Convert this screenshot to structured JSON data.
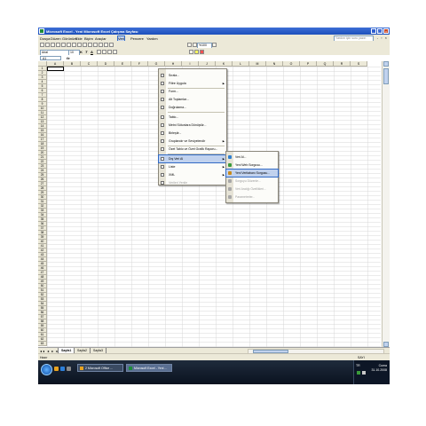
{
  "window": {
    "title": "Microsoft Excel - Yeni Microsoft Excel Çalışma Sayfası"
  },
  "menubar": {
    "items": [
      "Dosya",
      "Düzen",
      "Görünüm",
      "Ekle",
      "Biçim",
      "Araçlar",
      "Veri",
      "Pencere",
      "Yardım"
    ],
    "active_index": 6,
    "help_placeholder": "Yardım için soru yazın"
  },
  "toolbar": {
    "font": "Arial",
    "size": "10",
    "zoom": "%100"
  },
  "formula_bar": {
    "name_box": "A1",
    "fx": "fx"
  },
  "grid": {
    "columns": [
      "A",
      "B",
      "C",
      "D",
      "E",
      "F",
      "G",
      "H",
      "I",
      "J",
      "K",
      "L",
      "M",
      "N",
      "O",
      "P",
      "Q",
      "R",
      "S"
    ],
    "rows": [
      "1",
      "2",
      "3",
      "4",
      "5",
      "6",
      "7",
      "8",
      "9",
      "10",
      "11",
      "12",
      "13",
      "14",
      "15",
      "16",
      "17",
      "18",
      "19",
      "20",
      "21",
      "22",
      "23",
      "24",
      "25",
      "26",
      "27",
      "28",
      "29",
      "30",
      "31",
      "32",
      "33",
      "34",
      "35",
      "36",
      "37",
      "38",
      "39",
      "40",
      "41",
      "42",
      "43",
      "44",
      "45",
      "46",
      "47",
      "48",
      "49",
      "50",
      "51",
      "52",
      "53",
      "54",
      "55",
      "56",
      "57",
      "58",
      "59",
      "60",
      "61",
      "62",
      "63"
    ]
  },
  "veri_menu": {
    "items": [
      {
        "label": "Sırala...",
        "submenu": false,
        "disabled": false
      },
      {
        "label": "Filtre Uygula",
        "submenu": true,
        "disabled": false
      },
      {
        "label": "Form...",
        "submenu": false,
        "disabled": false
      },
      {
        "label": "Alt Toplamlar...",
        "submenu": false,
        "disabled": false
      },
      {
        "label": "Doğrulama...",
        "submenu": false,
        "disabled": false
      },
      {
        "label": "Tablo...",
        "submenu": false,
        "disabled": false
      },
      {
        "label": "Metni Sütunlara Dönüştür...",
        "submenu": false,
        "disabled": false
      },
      {
        "label": "Birleştir...",
        "submenu": false,
        "disabled": false
      },
      {
        "label": "Gruplandır ve Seviyelendir",
        "submenu": true,
        "disabled": false
      },
      {
        "label": "Özet Tablo ve Özet Grafik Raporu...",
        "submenu": false,
        "disabled": false
      },
      {
        "label": "Dış Veri Al",
        "submenu": true,
        "disabled": false,
        "highlighted": true
      },
      {
        "label": "Liste",
        "submenu": true,
        "disabled": false
      },
      {
        "label": "XML",
        "submenu": true,
        "disabled": false
      },
      {
        "label": "Verileri Yenile",
        "submenu": false,
        "disabled": true
      }
    ]
  },
  "submenu": {
    "items": [
      {
        "label": "Veri Al...",
        "disabled": false,
        "icon": "#2f7fd0"
      },
      {
        "label": "Yeni Web Sorgusu...",
        "disabled": false,
        "icon": "#3a9a3a"
      },
      {
        "label": "Yeni Veritabanı Sorgusu...",
        "disabled": false,
        "highlighted": true,
        "icon": "#c98a1a"
      },
      {
        "label": "Sorguyu Düzenle...",
        "disabled": true,
        "icon": "#a8a8a8"
      },
      {
        "label": "Veri Aralığı Özellikleri...",
        "disabled": true,
        "icon": "#a8a8a8"
      },
      {
        "label": "Parametreler...",
        "disabled": true,
        "icon": "#a8a8a8"
      }
    ]
  },
  "sheets": {
    "tabs": [
      "Sayfa1",
      "Sayfa2",
      "Sayfa3"
    ],
    "active_index": 0
  },
  "status": {
    "left": "Hazır",
    "right": "SAYI"
  },
  "taskbar": {
    "buttons": [
      {
        "label": "2 Microsoft Office ...",
        "active": false
      },
      {
        "label": "Microsoft Excel - Yeni ...",
        "active": true
      }
    ],
    "tray_lang": "TR",
    "clock": "Cuma",
    "date": "31.10.2008"
  }
}
